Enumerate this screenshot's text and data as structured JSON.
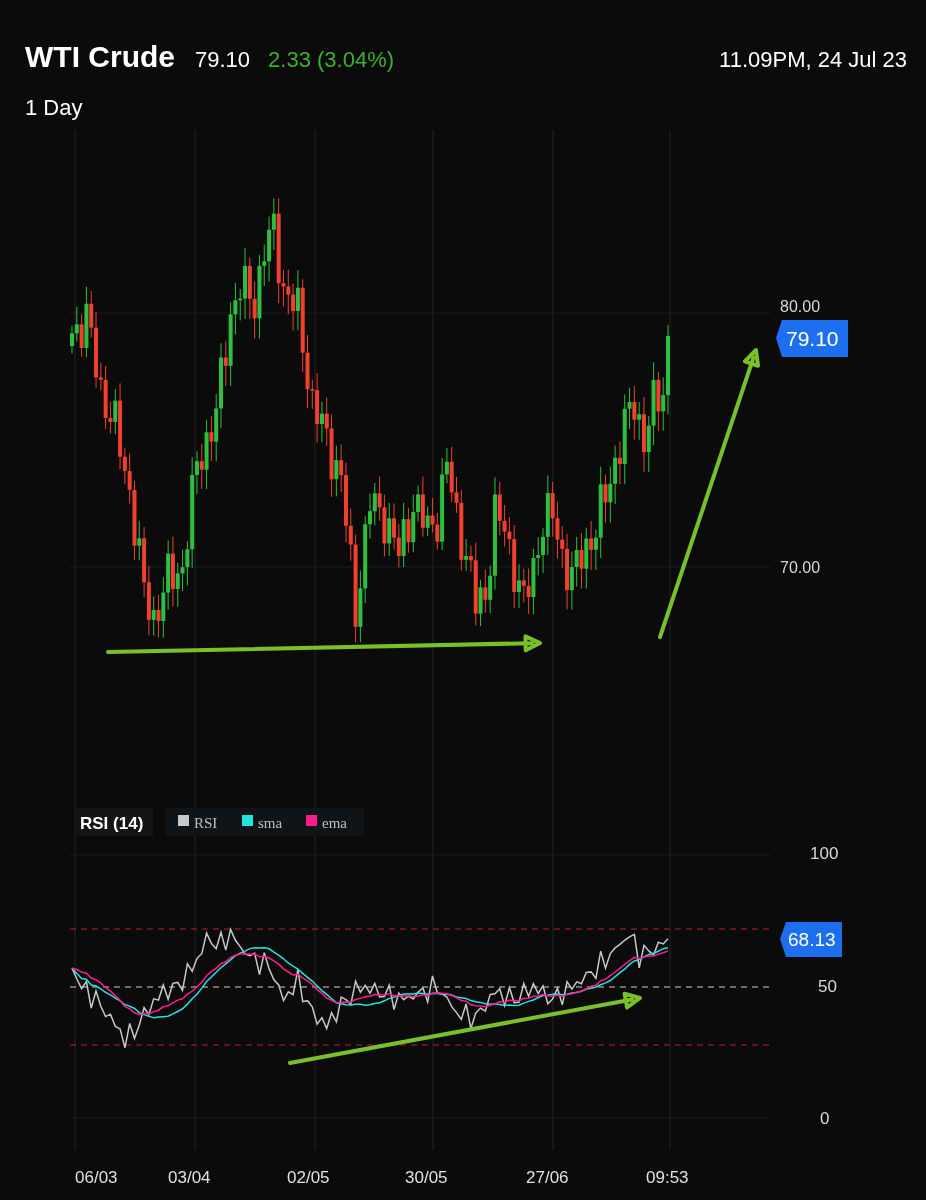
{
  "header": {
    "title": "WTI Crude",
    "price": "79.10",
    "change": "2.33 (3.04%)",
    "timestamp": "11.09PM, 24 Jul 23",
    "interval": "1 Day"
  },
  "price_chart": {
    "axis_labels": [
      "80.00",
      "70.00"
    ],
    "last_price_tag": "79.10"
  },
  "rsi_panel": {
    "label": "RSI (14)",
    "legend": [
      {
        "name": "RSI",
        "color": "#c8c8c8"
      },
      {
        "name": "sma",
        "color": "#22e5e0"
      },
      {
        "name": "ema",
        "color": "#ff1b8d"
      }
    ],
    "axis_labels": [
      "100",
      "50",
      "0"
    ],
    "last_value_tag": "68.13"
  },
  "x_axis": {
    "labels": [
      "06/03",
      "03/04",
      "02/05",
      "30/05",
      "27/06",
      "09:53"
    ]
  }
}
